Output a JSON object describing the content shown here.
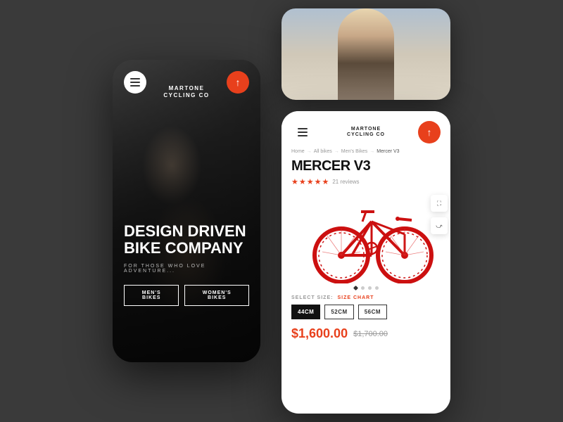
{
  "background_color": "#3a3a3a",
  "left_phone": {
    "brand": {
      "line1": "MARTONE",
      "line2": "CYCLING CO",
      "full": "MARTONE\nCYCLING CO"
    },
    "headline_line1": "DESIGN DRIVEN",
    "headline_line2": "BIKE COMPANY",
    "subtext": "FOR THOSE WHO LOVE ADVENTURE...",
    "btn_mens": "MEN'S BIKES",
    "btn_womens": "WOMEN'S BIKES",
    "menu_icon": "≡",
    "share_icon": "⬆"
  },
  "right_top_phone": {
    "description": "Man in suit photo"
  },
  "right_product_phone": {
    "brand": {
      "line1": "MARTONE",
      "line2": "CYCLING CO"
    },
    "menu_icon": "≡",
    "share_icon": "⬆",
    "breadcrumb": {
      "home": "Home",
      "all_bikes": "All bikes",
      "mens_bikes": "Men's Bikes",
      "current": "Mercer V3"
    },
    "product_title": "MERCER V3",
    "stars": "★★★★★",
    "reviews": "21 reviews",
    "expand_icon": "⛶",
    "share_icon2": "⤻",
    "dot_indicators": [
      "active",
      "inactive",
      "inactive",
      "inactive"
    ],
    "size_label": "SELECT SIZE:",
    "size_chart": "SIZE CHART",
    "sizes": [
      "44CM",
      "52CM",
      "56CM"
    ],
    "selected_size": "44CM",
    "current_price": "$1,600.00",
    "original_price": "$1,700.00"
  }
}
